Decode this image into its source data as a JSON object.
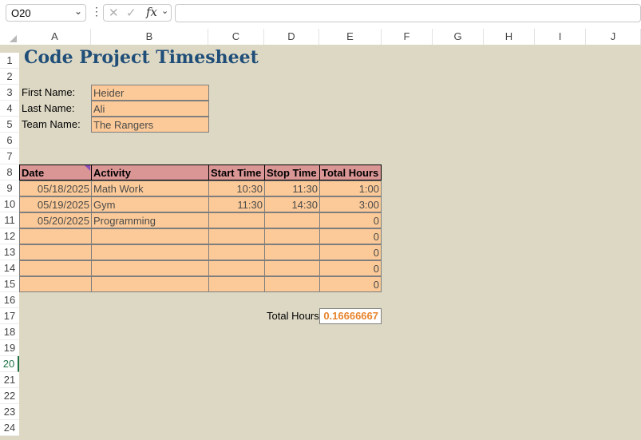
{
  "formula_bar": {
    "name_box": "O20",
    "name_box_chevron": "⌄",
    "menu_dots": "⋮",
    "cancel_glyph": "✕",
    "enter_glyph": "✓",
    "fx_label": "fx",
    "fx_chevron": "⌄",
    "formula_value": ""
  },
  "columns": [
    "A",
    "B",
    "C",
    "D",
    "E",
    "F",
    "G",
    "H",
    "I",
    "J"
  ],
  "rows": [
    "1",
    "2",
    "3",
    "4",
    "5",
    "6",
    "7",
    "8",
    "9",
    "10",
    "11",
    "12",
    "13",
    "14",
    "15",
    "16",
    "17",
    "18",
    "19",
    "20",
    "21",
    "22",
    "23",
    "24"
  ],
  "selected_row": "20",
  "title": "Code Project Timesheet",
  "info": {
    "first_name_label": "First Name:",
    "first_name": "Heider",
    "last_name_label": "Last Name:",
    "last_name": "Ali",
    "team_name_label": "Team Name:",
    "team_name": "The Rangers"
  },
  "table": {
    "headers": [
      "Date",
      "Activity",
      "Start Time",
      "Stop Time",
      "Total Hours"
    ],
    "rows": [
      [
        "05/18/2025",
        "Math Work",
        "10:30",
        "11:30",
        "1:00"
      ],
      [
        "05/19/2025",
        "Gym",
        "11:30",
        "14:30",
        "3:00"
      ],
      [
        "05/20/2025",
        "Programming",
        "",
        "",
        "0"
      ],
      [
        "",
        "",
        "",
        "",
        "0"
      ],
      [
        "",
        "",
        "",
        "",
        "0"
      ],
      [
        "",
        "",
        "",
        "",
        "0"
      ],
      [
        "",
        "",
        "",
        "",
        "0"
      ]
    ]
  },
  "total": {
    "label": "Total Hours",
    "value": "0.16666667"
  },
  "colors": {
    "sheet_background": "#ddd8c4",
    "input_fill": "#fcca98",
    "header_fill": "#da9595",
    "title": "#1f4e79",
    "total_value": "#e8842c",
    "selection": "#1e7145"
  }
}
